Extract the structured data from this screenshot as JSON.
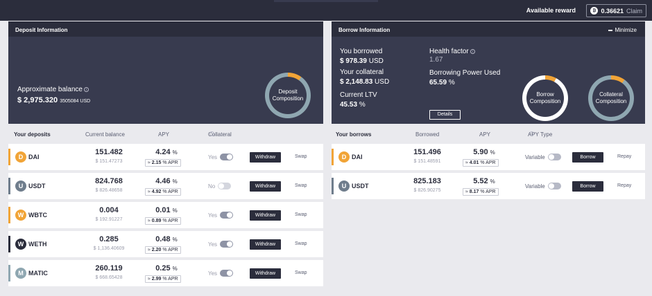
{
  "header": {
    "reward_label": "Available reward",
    "reward_value": "0.36621",
    "claim_label": "Claim"
  },
  "deposit_info": {
    "title": "Deposit Information",
    "approx_label": "Approximate balance",
    "approx_value": "$ 2,975.320",
    "approx_sub": "3505084 USD",
    "donut_label": "Deposit Composition"
  },
  "borrow_info": {
    "title": "Borrow Information",
    "minimize_label": "Minimize",
    "borrowed_label": "You borrowed",
    "borrowed_value": "$ 978.39",
    "borrowed_unit": "USD",
    "collateral_label": "Your collateral",
    "collateral_value": "$ 2,148.83",
    "collateral_unit": "USD",
    "ltv_label": "Current LTV",
    "ltv_value": "45.53",
    "ltv_unit": "%",
    "hf_label": "Health factor",
    "hf_value": "1.67",
    "power_label": "Borrowing Power Used",
    "power_value": "65.59",
    "power_unit": "%",
    "details_label": "Details",
    "borrow_donut_label": "Borrow Composition",
    "collateral_donut_label": "Collateral Composition"
  },
  "deposits": {
    "headers": {
      "name": "Your deposits",
      "balance": "Current balance",
      "apy": "APY",
      "collateral": "Collateral"
    },
    "rows": [
      {
        "symbol": "DAI",
        "icon": "dai-icon",
        "color": "#f1a437",
        "balance": "151.482",
        "usd": "$ 151.47273",
        "apy": "4.24",
        "apr": "2.15",
        "collateral_label": "Yes",
        "collateral_on": true,
        "action_label": "Withdraw",
        "swap_label": "Swap"
      },
      {
        "symbol": "USDT",
        "icon": "usdt-icon",
        "color": "#6f7d8c",
        "balance": "824.768",
        "usd": "$ 826.48658",
        "apy": "4.46",
        "apr": "4.92",
        "collateral_label": "No",
        "collateral_on": false,
        "action_label": "Withdraw",
        "swap_label": "Swap"
      },
      {
        "symbol": "WBTC",
        "icon": "wbtc-icon",
        "color": "#f1a437",
        "balance": "0.004",
        "usd": "$ 192.91227",
        "apy": "0.01",
        "apr": "0.89",
        "collateral_label": "Yes",
        "collateral_on": true,
        "action_label": "Withdraw",
        "swap_label": "Swap"
      },
      {
        "symbol": "WETH",
        "icon": "weth-icon",
        "color": "#2b2d3c",
        "balance": "0.285",
        "usd": "$ 1,136.40609",
        "apy": "0.48",
        "apr": "2.20",
        "collateral_label": "Yes",
        "collateral_on": true,
        "action_label": "Withdraw",
        "swap_label": "Swap"
      },
      {
        "symbol": "MATIC",
        "icon": "matic-icon",
        "color": "#8fa7b1",
        "balance": "260.119",
        "usd": "$ 668.65428",
        "apy": "0.25",
        "apr": "2.99",
        "collateral_label": "Yes",
        "collateral_on": true,
        "action_label": "Withdraw",
        "swap_label": "Swap"
      }
    ]
  },
  "borrows": {
    "headers": {
      "name": "Your borrows",
      "borrowed": "Borrowed",
      "apy": "APY",
      "apy_type": "APY Type"
    },
    "rows": [
      {
        "symbol": "DAI",
        "icon": "dai-icon",
        "color": "#f1a437",
        "borrowed": "151.496",
        "usd": "$ 151.48591",
        "apy": "5.90",
        "apr": "4.01",
        "type_label": "Variable",
        "action_label": "Borrow",
        "repay_label": "Repay"
      },
      {
        "symbol": "USDT",
        "icon": "usdt-icon",
        "color": "#6f7d8c",
        "borrowed": "825.183",
        "usd": "$ 826.90275",
        "apy": "5.52",
        "apr": "8.17",
        "type_label": "Variable",
        "action_label": "Borrow",
        "repay_label": "Repay"
      }
    ]
  },
  "apr_suffix": "APR",
  "pct_suffix": "%"
}
